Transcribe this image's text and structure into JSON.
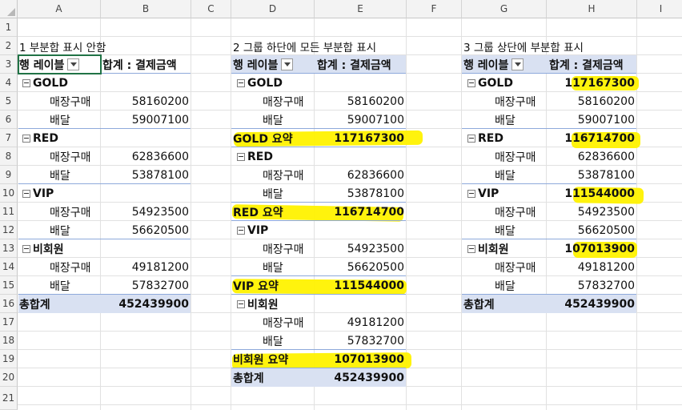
{
  "columns": [
    "A",
    "B",
    "C",
    "D",
    "E",
    "F",
    "G",
    "H",
    "I"
  ],
  "rows": [
    "1",
    "2",
    "3",
    "4",
    "5",
    "6",
    "7",
    "8",
    "9",
    "10",
    "11",
    "12",
    "13",
    "14",
    "15",
    "16",
    "17",
    "18",
    "19",
    "20",
    "21"
  ],
  "tables": {
    "t1": {
      "caption": "1  부분합 표시 안함",
      "row_label": "행 레이블",
      "value_label": "합계 : 결제금액",
      "groups": [
        {
          "name": "GOLD",
          "items": [
            {
              "name": "매장구매",
              "value": "58160200"
            },
            {
              "name": "배달",
              "value": "59007100"
            }
          ]
        },
        {
          "name": "RED",
          "items": [
            {
              "name": "매장구매",
              "value": "62836600"
            },
            {
              "name": "배달",
              "value": "53878100"
            }
          ]
        },
        {
          "name": "VIP",
          "items": [
            {
              "name": "매장구매",
              "value": "54923500"
            },
            {
              "name": "배달",
              "value": "56620500"
            }
          ]
        },
        {
          "name": "비회원",
          "items": [
            {
              "name": "매장구매",
              "value": "49181200"
            },
            {
              "name": "배달",
              "value": "57832700"
            }
          ]
        }
      ],
      "grand_label": "총합계",
      "grand_value": "452439900"
    },
    "t2": {
      "caption": "2 그룹 하단에 모든 부분합 표시",
      "row_label": "행 레이블",
      "value_label": "합계 : 결제금액",
      "groups": [
        {
          "name": "GOLD",
          "items": [
            {
              "name": "매장구매",
              "value": "58160200"
            },
            {
              "name": "배달",
              "value": "59007100"
            }
          ],
          "subtotal_label": "GOLD 요약",
          "subtotal": "117167300"
        },
        {
          "name": "RED",
          "items": [
            {
              "name": "매장구매",
              "value": "62836600"
            },
            {
              "name": "배달",
              "value": "53878100"
            }
          ],
          "subtotal_label": "RED 요약",
          "subtotal": "116714700"
        },
        {
          "name": "VIP",
          "items": [
            {
              "name": "매장구매",
              "value": "54923500"
            },
            {
              "name": "배달",
              "value": "56620500"
            }
          ],
          "subtotal_label": "VIP 요약",
          "subtotal": "111544000"
        },
        {
          "name": "비회원",
          "items": [
            {
              "name": "매장구매",
              "value": "49181200"
            },
            {
              "name": "배달",
              "value": "57832700"
            }
          ],
          "subtotal_label": "비회원 요약",
          "subtotal": "107013900"
        }
      ],
      "grand_label": "총합계",
      "grand_value": "452439900"
    },
    "t3": {
      "caption": "3 그룹 상단에 부분합 표시",
      "row_label": "행 레이블",
      "value_label": "합계 : 결제금액",
      "groups": [
        {
          "name": "GOLD",
          "subtotal": "117167300",
          "items": [
            {
              "name": "매장구매",
              "value": "58160200"
            },
            {
              "name": "배달",
              "value": "59007100"
            }
          ]
        },
        {
          "name": "RED",
          "subtotal": "116714700",
          "items": [
            {
              "name": "매장구매",
              "value": "62836600"
            },
            {
              "name": "배달",
              "value": "53878100"
            }
          ]
        },
        {
          "name": "VIP",
          "subtotal": "111544000",
          "items": [
            {
              "name": "매장구매",
              "value": "54923500"
            },
            {
              "name": "배달",
              "value": "56620500"
            }
          ]
        },
        {
          "name": "비회원",
          "subtotal": "107013900",
          "items": [
            {
              "name": "매장구매",
              "value": "49181200"
            },
            {
              "name": "배달",
              "value": "57832700"
            }
          ]
        }
      ],
      "grand_label": "총합계",
      "grand_value": "452439900"
    }
  },
  "colors": {
    "header_band": "#d9e1f2",
    "highlight": "#fff200",
    "selection": "#217346"
  },
  "icons": {
    "filter_dropdown": "chevron-down-icon",
    "collapse": "minus-box-icon"
  }
}
